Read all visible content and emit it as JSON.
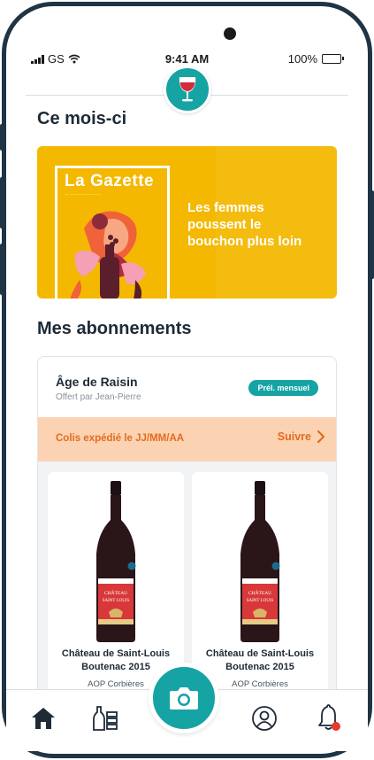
{
  "status_bar": {
    "carrier": "GS",
    "time": "9:41 AM",
    "battery": "100%"
  },
  "header": {
    "logo_icon": "wine-glass-icon"
  },
  "this_month": {
    "title": "Ce mois-ci",
    "banner": {
      "magazine_title": "La Gazette",
      "headline": "Les femmes poussent le bouchon plus loin"
    }
  },
  "subscriptions": {
    "title": "Mes abonnements",
    "card": {
      "name": "Âge de Raisin",
      "offered_by": "Offert par Jean-Pierre",
      "badge": "Prél. mensuel",
      "shipping_text": "Colis expédié le JJ/MM/AA",
      "follow_label": "Suivre",
      "wines": [
        {
          "name": "Château de Saint-Louis Boutenac 2015",
          "appellation": "AOP Corbières",
          "label_line1": "CHÂTEAU",
          "label_line2": "SAINT LOUIS"
        },
        {
          "name": "Château de Saint-Louis Boutenac 2015",
          "appellation": "AOP Corbières",
          "label_line1": "CHÂTEAU",
          "label_line2": "SAINT LOUIS"
        }
      ]
    }
  },
  "bottom_nav": {
    "items": [
      "home-icon",
      "cellar-icon",
      "camera-icon",
      "profile-icon",
      "notification-bell-icon"
    ]
  },
  "colors": {
    "accent": "#16a3a4",
    "banner": "#f4b800",
    "shipping_bg": "#fbd3b3",
    "shipping_text": "#e46b1f",
    "frame": "#1f3444",
    "notification_dot": "#e63a2e"
  }
}
